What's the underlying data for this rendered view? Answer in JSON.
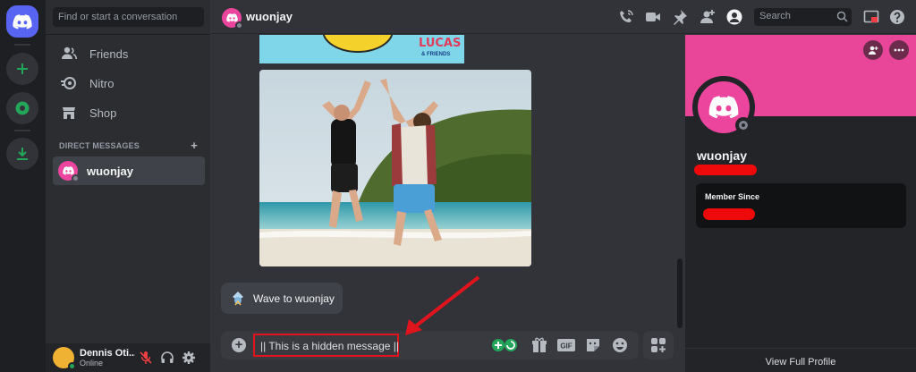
{
  "sidebar": {
    "search_placeholder": "Find or start a conversation",
    "nav_items": [
      {
        "label": "Friends",
        "icon": "friends-icon"
      },
      {
        "label": "Nitro",
        "icon": "nitro-icon"
      },
      {
        "label": "Shop",
        "icon": "shop-icon"
      }
    ],
    "dm_header": "DIRECT MESSAGES",
    "dm_add": "+",
    "dms": [
      {
        "name": "wuonjay",
        "status": "offline"
      }
    ],
    "user": {
      "name": "Dennis Oti...",
      "status": "Online"
    }
  },
  "header": {
    "channel_name": "wuonjay",
    "search_placeholder": "Search"
  },
  "chat": {
    "banner_logo": "LUCAS",
    "banner_logo_sub": "& FRIENDS",
    "wave_label": "Wave to wuonjay",
    "composer_text": "|| This is a hidden message ||"
  },
  "profile": {
    "name": "wuonjay",
    "member_since_label": "Member Since",
    "footer": "View Full Profile"
  },
  "colors": {
    "accent": "#5865f2",
    "profile_banner": "#e9469a",
    "highlight": "#e0141c",
    "online": "#23a55a"
  }
}
